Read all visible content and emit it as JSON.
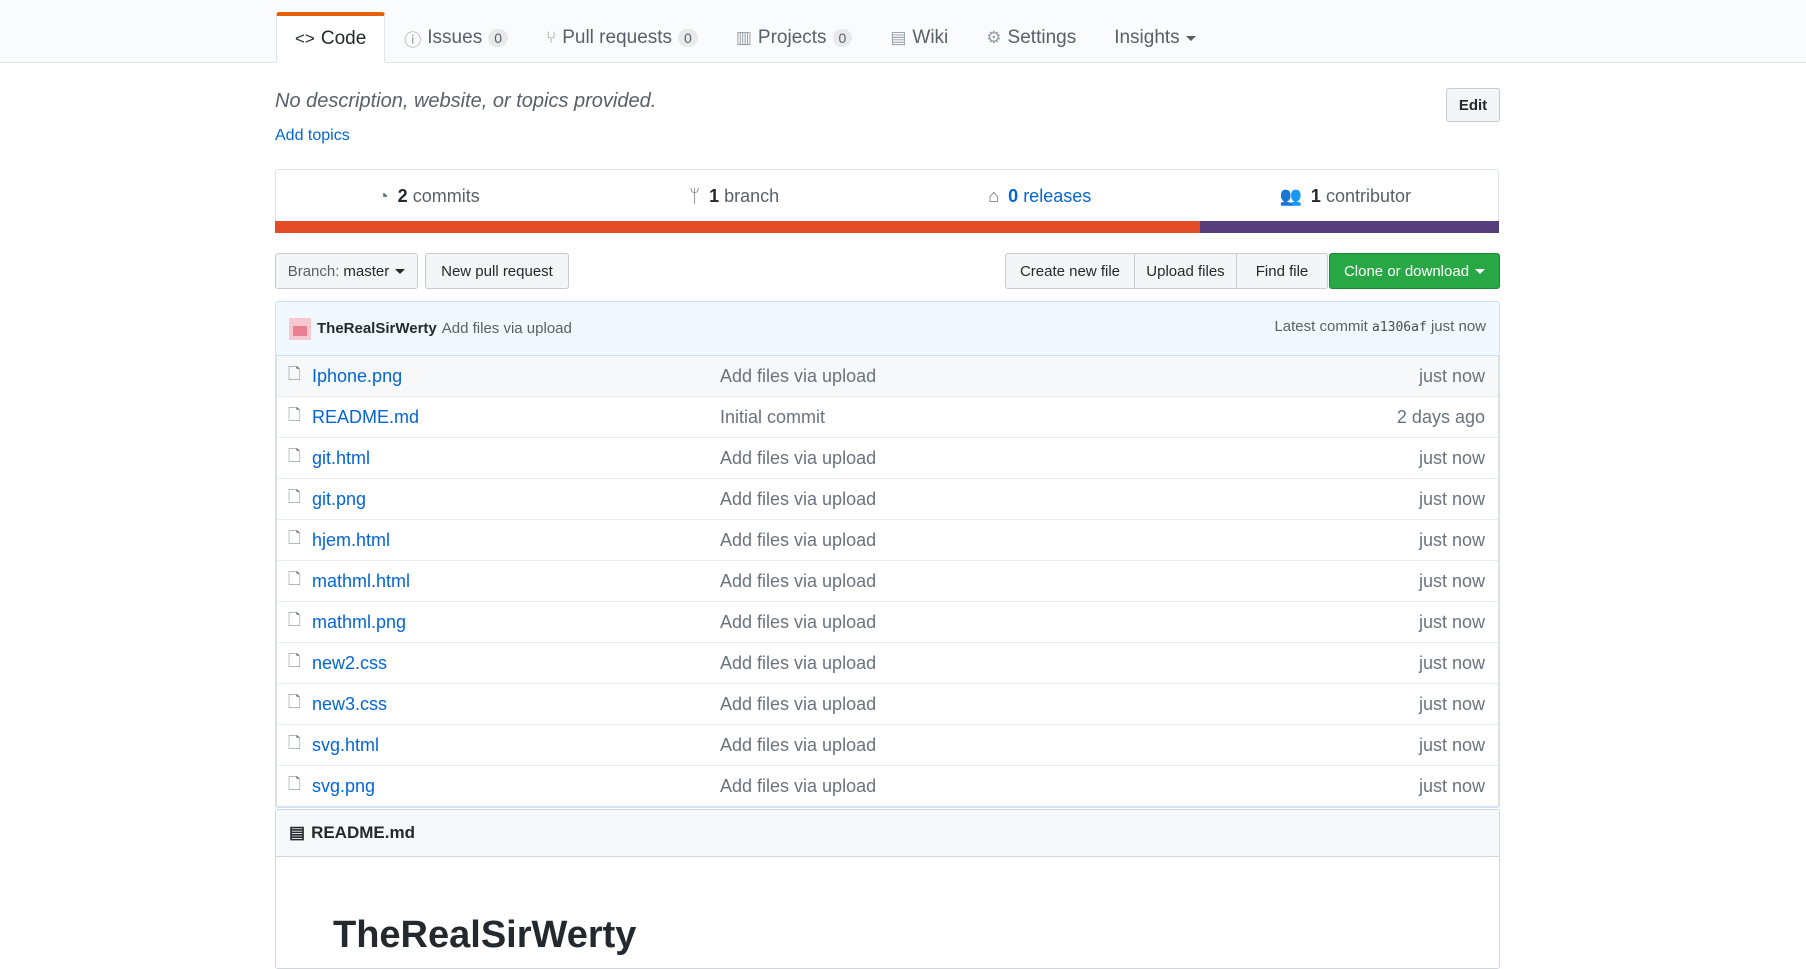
{
  "tabs": [
    {
      "label": "Code",
      "icon": "code-icon",
      "counter": null
    },
    {
      "label": "Issues",
      "icon": "issue-icon",
      "counter": "0"
    },
    {
      "label": "Pull requests",
      "icon": "pull-request-icon",
      "counter": "0"
    },
    {
      "label": "Projects",
      "icon": "project-icon",
      "counter": "0"
    },
    {
      "label": "Wiki",
      "icon": "book-icon",
      "counter": null
    },
    {
      "label": "Settings",
      "icon": "gear-icon",
      "counter": null
    },
    {
      "label": "Insights",
      "icon": null,
      "counter": null
    }
  ],
  "repo": {
    "description": "No description, website, or topics provided.",
    "add_topics": "Add topics",
    "edit_label": "Edit"
  },
  "summary": {
    "commits_num": "2",
    "commits_label": "commits",
    "branch_num": "1",
    "branch_label": "branch",
    "releases_num": "0",
    "releases_label": "releases",
    "contributor_num": "1",
    "contributor_label": "contributor"
  },
  "languages": [
    {
      "color": "#e34c26",
      "percent": 75.6
    },
    {
      "color": "#563d7c",
      "percent": 24.4
    }
  ],
  "toolbar": {
    "branch_prefix": "Branch:",
    "branch_name": "master",
    "new_pr": "New pull request",
    "create_file": "Create new file",
    "upload_files": "Upload files",
    "find_file": "Find file",
    "clone": "Clone or download"
  },
  "latest_commit": {
    "author": "TheRealSirWerty",
    "message": "Add files via upload",
    "prefix": "Latest commit",
    "sha": "a1306af",
    "age": "just now"
  },
  "files": [
    {
      "name": "Iphone.png",
      "message": "Add files via upload",
      "age": "just now"
    },
    {
      "name": "README.md",
      "message": "Initial commit",
      "age": "2 days ago"
    },
    {
      "name": "git.html",
      "message": "Add files via upload",
      "age": "just now"
    },
    {
      "name": "git.png",
      "message": "Add files via upload",
      "age": "just now"
    },
    {
      "name": "hjem.html",
      "message": "Add files via upload",
      "age": "just now"
    },
    {
      "name": "mathml.html",
      "message": "Add files via upload",
      "age": "just now"
    },
    {
      "name": "mathml.png",
      "message": "Add files via upload",
      "age": "just now"
    },
    {
      "name": "new2.css",
      "message": "Add files via upload",
      "age": "just now"
    },
    {
      "name": "new3.css",
      "message": "Add files via upload",
      "age": "just now"
    },
    {
      "name": "svg.html",
      "message": "Add files via upload",
      "age": "just now"
    },
    {
      "name": "svg.png",
      "message": "Add files via upload",
      "age": "just now"
    }
  ],
  "readme": {
    "title": "README.md",
    "heading": "TheRealSirWerty"
  }
}
